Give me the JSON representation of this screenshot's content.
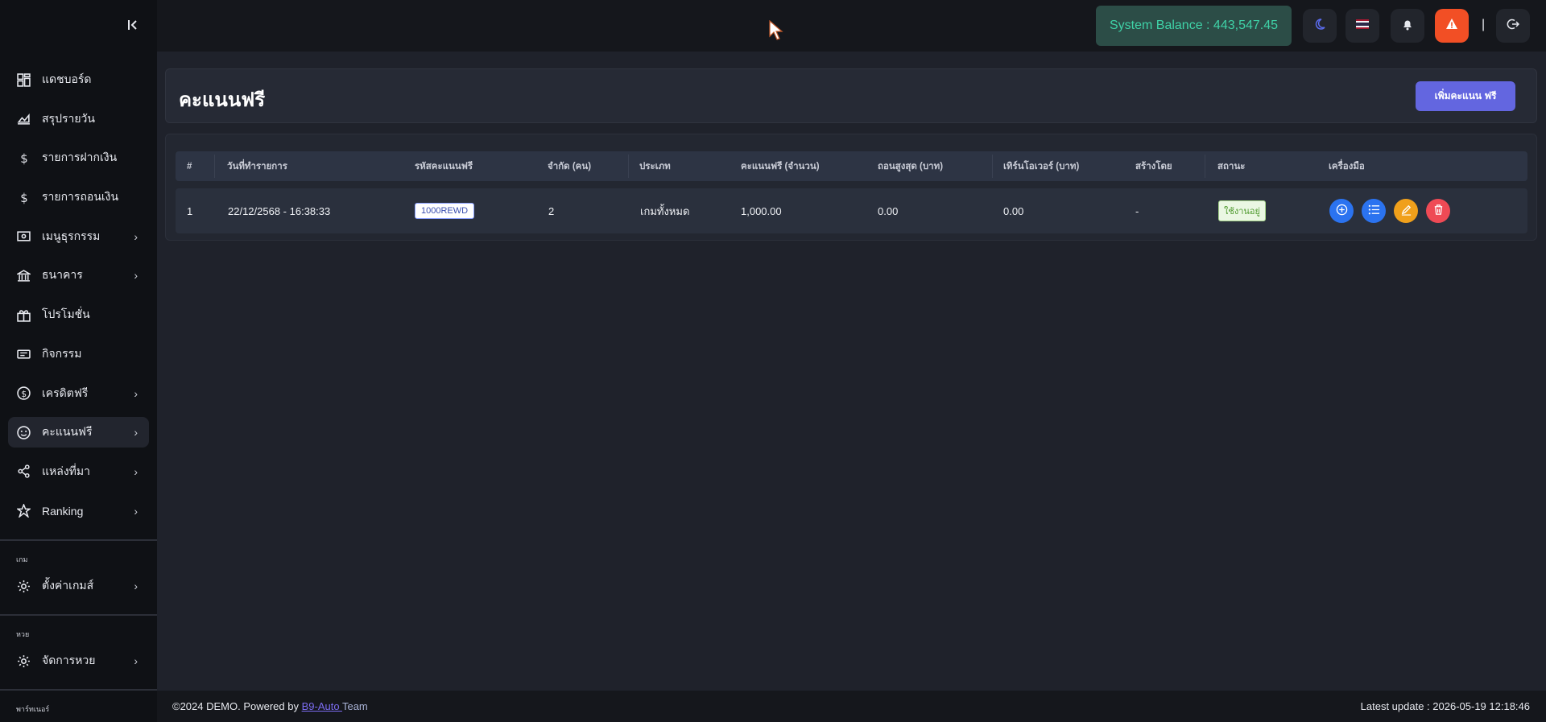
{
  "sidebar": {
    "items": [
      {
        "label": "แดชบอร์ด",
        "icon": "grid-icon"
      },
      {
        "label": "สรุปรายวัน",
        "icon": "chart-area-icon"
      },
      {
        "label": "รายการฝากเงิน",
        "icon": "dollar-icon"
      },
      {
        "label": "รายการถอนเงิน",
        "icon": "dollar-icon"
      },
      {
        "label": "เมนูธุรกรรม",
        "icon": "cash-icon"
      },
      {
        "label": "ธนาคาร",
        "icon": "bank-icon"
      },
      {
        "label": "โปรโมชั่น",
        "icon": "gift-icon"
      },
      {
        "label": "กิจกรรม",
        "icon": "ticket-icon"
      },
      {
        "label": "เครดิตฟรี",
        "icon": "coin-icon"
      },
      {
        "label": "คะแนนฟรี",
        "icon": "smile-icon"
      },
      {
        "label": "แหล่งที่มา",
        "icon": "share-icon"
      },
      {
        "label": "Ranking",
        "icon": "star-icon"
      }
    ],
    "section_game": {
      "title": "เกม",
      "item": "ตั้งค่าเกมส์"
    },
    "section_lotto": {
      "title": "หวย",
      "item": "จัดการหวย"
    },
    "section_partner": {
      "title": "พาร์ทเนอร์"
    }
  },
  "header": {
    "balance": "System Balance : 443,547.45",
    "separator": "|"
  },
  "page": {
    "title": "คะแนนฟรี",
    "add_button": "เพิ่มคะแนน ฟรี"
  },
  "table": {
    "headers": [
      "#",
      "วันที่ทำรายการ",
      "รหัสคะแนนฟรี",
      "จำกัด (คน)",
      "ประเภท",
      "คะแนนฟรี (จำนวน)",
      "ถอนสูงสุด (บาท)",
      "เทิร์นโอเวอร์ (บาท)",
      "สร้างโดย",
      "สถานะ",
      "เครื่องมือ"
    ],
    "rows": [
      {
        "no": "1",
        "date": "22/12/2568 - 16:38:33",
        "code": "1000REWD",
        "limit": "2",
        "type": "เกมทั้งหมด",
        "points": "1,000.00",
        "max_withdraw": "0.00",
        "turnover": "0.00",
        "created_by": "-",
        "status": "ใช้งานอยู่"
      }
    ]
  },
  "footer": {
    "copyright": "©2024 DEMO. Powered by ",
    "link": "B9-Auto ",
    "team": "Team",
    "last_update": "Latest update : 2026-05-19 12:18:46"
  },
  "colors": {
    "accent": "#6366e0",
    "balance_text": "#3fd2a7",
    "alert": "#f24f25"
  }
}
